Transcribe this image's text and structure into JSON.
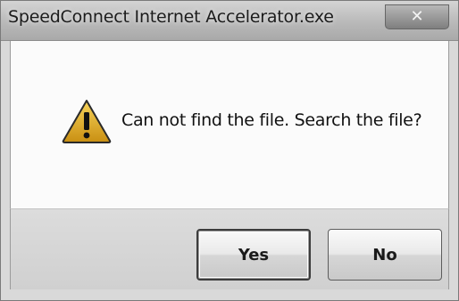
{
  "window": {
    "title": "SpeedConnect Internet Accelerator.exe",
    "close_symbol": "✕"
  },
  "dialog": {
    "icon": "warning-icon",
    "message": "Can not find the file. Search the file?"
  },
  "buttons": {
    "yes_label": "Yes",
    "no_label": "No"
  },
  "colors": {
    "warning_triangle": "#d9a21b",
    "dialog_background": "#fbfbfb",
    "button_area": "#d6d6d6"
  }
}
